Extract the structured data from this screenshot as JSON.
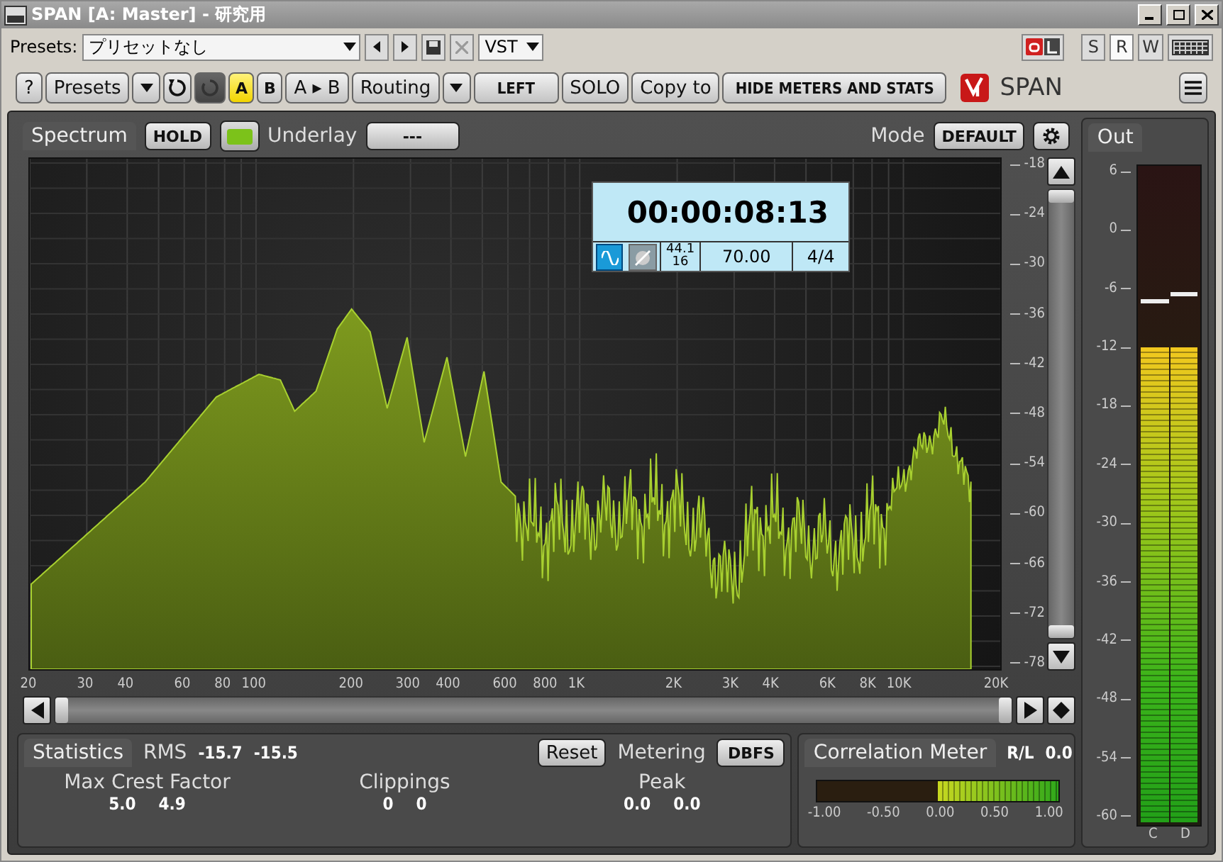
{
  "window": {
    "title": "SPAN [A: Master] - 研究用"
  },
  "preset_bar": {
    "label": "Presets:",
    "preset": "プリセットなし",
    "format": "VST",
    "view_buttons": [
      {
        "label": "S",
        "selected": false
      },
      {
        "label": "R",
        "selected": true
      },
      {
        "label": "W",
        "selected": false
      }
    ]
  },
  "toolbar": {
    "buttons": [
      {
        "kind": "button",
        "label": "?"
      },
      {
        "kind": "button",
        "label": "Presets"
      },
      {
        "kind": "caret"
      },
      {
        "kind": "reset"
      },
      {
        "kind": "power",
        "on": false
      },
      {
        "kind": "slot",
        "label": "A",
        "selected": true
      },
      {
        "kind": "slot",
        "label": "B",
        "selected": false
      },
      {
        "kind": "button",
        "label": "A ▸ B"
      },
      {
        "kind": "button",
        "label": "Routing"
      },
      {
        "kind": "caret"
      },
      {
        "kind": "wide",
        "label": "LEFT"
      },
      {
        "kind": "button",
        "label": "SOLO"
      },
      {
        "kind": "button",
        "label": "Copy to"
      },
      {
        "kind": "wide",
        "label": "HIDE METERS AND STATS"
      }
    ],
    "logo": "SPAN"
  },
  "spectrum": {
    "title": "Spectrum",
    "hold": "HOLD",
    "hold_color_on": true,
    "underlay_label": "Underlay",
    "underlay": "---",
    "mode_label": "Mode",
    "mode": "DEFAULT",
    "transport": {
      "time": "00:00:08:13",
      "wave_on": true,
      "link_on": false,
      "sample_rate": "44.1",
      "bit_depth": "16",
      "tempo": "70.00",
      "signature": "4/4"
    },
    "db_labels": [
      "-18",
      "-24",
      "-30",
      "-36",
      "-42",
      "-48",
      "-54",
      "-60",
      "-66",
      "-72",
      "-78"
    ],
    "freq_labels": [
      "20",
      "30",
      "40",
      "60",
      "80",
      "100",
      "200",
      "300",
      "400",
      "600",
      "800",
      "1K",
      "2K",
      "3K",
      "4K",
      "6K",
      "8K",
      "10K",
      "20K"
    ]
  },
  "statistics": {
    "title": "Statistics",
    "rms_label": "RMS",
    "rms": [
      "-15.7",
      "-15.5"
    ],
    "reset": "Reset",
    "metering_label": "Metering",
    "metering": "DBFS",
    "items": [
      {
        "label": "Max Crest Factor",
        "values": [
          "5.0",
          "4.9"
        ]
      },
      {
        "label": "Clippings",
        "values": [
          "0",
          "0"
        ]
      },
      {
        "label": "Peak",
        "values": [
          "0.0",
          "0.0"
        ]
      }
    ]
  },
  "correlation": {
    "title": "Correlation Meter",
    "channel": "R/L",
    "value": "0.0",
    "level": 0.5,
    "scale": [
      "-1.00",
      "-0.50",
      "0.00",
      "0.50",
      "1.00"
    ]
  },
  "out": {
    "title": "Out",
    "scale": [
      "6",
      "0",
      "-6",
      "-12",
      "-18",
      "-24",
      "-30",
      "-36",
      "-42",
      "-48",
      "-54",
      "-60"
    ],
    "channels": [
      {
        "label": "C",
        "level": 0.727,
        "peak": {
          "level": 0.795
        }
      },
      {
        "label": "D",
        "level": 0.727,
        "peak": {
          "level": 0.805
        }
      }
    ]
  }
}
